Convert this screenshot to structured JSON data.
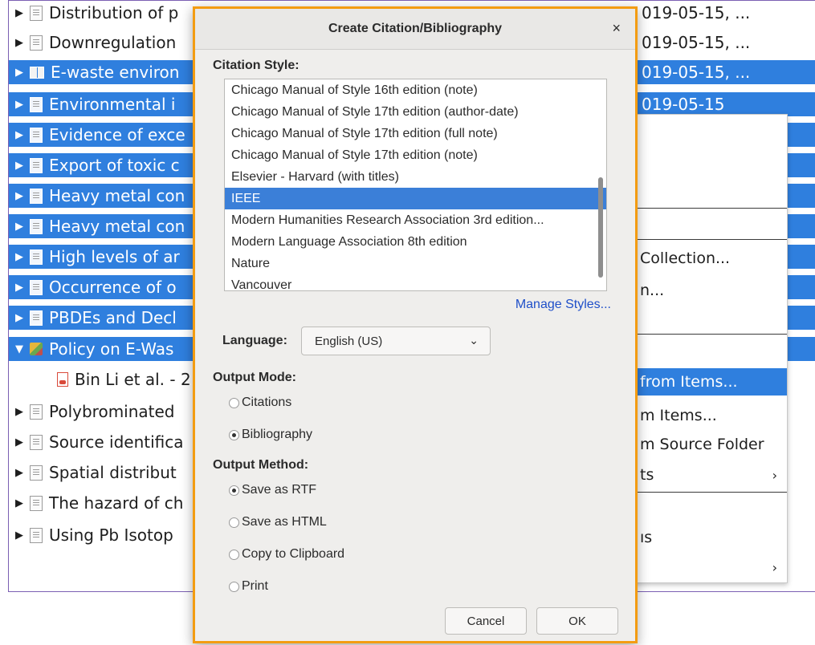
{
  "list": {
    "rows": [
      {
        "title": "Distribution of p",
        "date": "019-05-15, ...",
        "icon": "document-icon",
        "selected": false,
        "twisty": "▶"
      },
      {
        "title": "Downregulation",
        "date": "019-05-15, ...",
        "icon": "document-icon",
        "selected": false,
        "twisty": "▶"
      },
      {
        "title": "E-waste environ",
        "date": "019-05-15, ...",
        "icon": "book-icon",
        "selected": true,
        "twisty": "▶"
      },
      {
        "title": "Environmental i",
        "date": "019-05-15",
        "icon": "document-icon",
        "selected": true,
        "twisty": "▶"
      },
      {
        "title": "Evidence of exce",
        "date": "",
        "icon": "document-icon",
        "selected": true,
        "twisty": "▶"
      },
      {
        "title": "Export of toxic c",
        "date": "",
        "icon": "document-icon",
        "selected": true,
        "twisty": "▶"
      },
      {
        "title": "Heavy metal con",
        "date": "",
        "icon": "document-icon",
        "selected": true,
        "twisty": "▶"
      },
      {
        "title": "Heavy metal con",
        "date": "",
        "icon": "document-icon",
        "selected": true,
        "twisty": "▶"
      },
      {
        "title": "High levels of ar",
        "date": "",
        "icon": "document-icon",
        "selected": true,
        "twisty": "▶"
      },
      {
        "title": "Occurrence of o",
        "date": "",
        "icon": "document-icon",
        "selected": true,
        "twisty": "▶"
      },
      {
        "title": "PBDEs and Decl",
        "date": "",
        "icon": "document-icon",
        "selected": true,
        "twisty": "▶"
      },
      {
        "title": "Policy on E-Was",
        "date": "",
        "icon": "policy-icon",
        "selected": true,
        "twisty": "▼"
      },
      {
        "title": "Bin Li et al. - 2",
        "date": "",
        "icon": "pdf-icon",
        "selected": false,
        "twisty": ""
      },
      {
        "title": "Polybrominated",
        "date": "",
        "icon": "document-icon",
        "selected": false,
        "twisty": "▶"
      },
      {
        "title": "Source identifica",
        "date": "",
        "icon": "document-icon",
        "selected": false,
        "twisty": "▶"
      },
      {
        "title": "Spatial distribut",
        "date": "",
        "icon": "document-icon",
        "selected": false,
        "twisty": "▶"
      },
      {
        "title": "The hazard of ch",
        "date": "",
        "icon": "document-icon",
        "selected": false,
        "twisty": "▶"
      },
      {
        "title": "Using Pb Isotop",
        "date": "",
        "icon": "document-icon",
        "selected": false,
        "twisty": "▶"
      }
    ]
  },
  "context_menu": {
    "items": [
      {
        "label": "Collection...",
        "highlighted": false
      },
      {
        "label": "n...",
        "highlighted": false
      },
      {
        "label": "from Items...",
        "highlighted": true
      },
      {
        "label": "m Items...",
        "highlighted": false
      },
      {
        "label": "m Source Folder",
        "highlighted": false
      },
      {
        "label": "ts",
        "highlighted": false
      },
      {
        "label": "ıs",
        "highlighted": false
      }
    ],
    "arrow": "›"
  },
  "dialog": {
    "title": "Create Citation/Bibliography",
    "close_glyph": "×",
    "citation_style_label": "Citation Style:",
    "styles": [
      "Chicago Manual of Style 16th edition (note)",
      "Chicago Manual of Style 17th edition (author-date)",
      "Chicago Manual of Style 17th edition (full note)",
      "Chicago Manual of Style 17th edition (note)",
      "Elsevier - Harvard (with titles)",
      "IEEE",
      "Modern Humanities Research Association 3rd edition...",
      "Modern Language Association 8th edition",
      "Nature",
      "Vancouver"
    ],
    "selected_style": "IEEE",
    "manage_styles": "Manage Styles...",
    "language_label": "Language:",
    "language_value": "English (US)",
    "output_mode_label": "Output Mode:",
    "output_modes": [
      "Citations",
      "Bibliography"
    ],
    "selected_output_mode": "Bibliography",
    "output_method_label": "Output Method:",
    "output_methods": [
      "Save as RTF",
      "Save as HTML",
      "Copy to Clipboard",
      "Print"
    ],
    "selected_output_method": "Save as RTF",
    "cancel_label": "Cancel",
    "ok_label": "OK"
  }
}
